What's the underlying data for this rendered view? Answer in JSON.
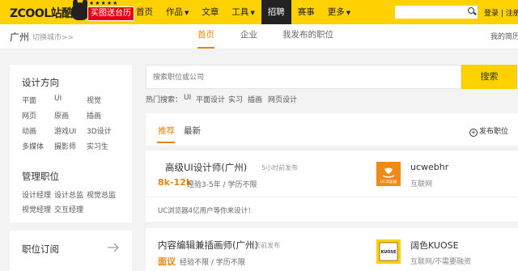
{
  "header": {
    "logo_text": "ZCOOL站酷",
    "promo": "买图送台历",
    "nav": [
      {
        "label": "首页"
      },
      {
        "label": "作品",
        "caret": "▼"
      },
      {
        "label": "文章"
      },
      {
        "label": "工具",
        "caret": "▼"
      },
      {
        "label": "招聘"
      },
      {
        "label": "赛事"
      },
      {
        "label": "更多",
        "caret": "▼"
      }
    ],
    "search_placeholder": "",
    "auth": "登录 | 注册"
  },
  "subheader": {
    "city": "广州",
    "switch_city": "切换城市>>",
    "tabs": [
      "首页",
      "企业",
      "我发布的职位"
    ],
    "resume": "我的简历"
  },
  "sidebar": {
    "design_title": "设计方向",
    "design_links": [
      "平面",
      "UI",
      "视觉",
      "网页",
      "原画",
      "插画",
      "动画",
      "游戏UI",
      "3D设计",
      "多媒体",
      "摄影师",
      "实习生"
    ],
    "manage_title": "管理职位",
    "manage_links": [
      "设计经理",
      "设计总监",
      "视觉总监",
      "视觉经理",
      "交互经理"
    ],
    "subscribe_title": "职位订阅"
  },
  "search": {
    "placeholder": "搜索职位或公司",
    "button": "搜索",
    "hot_label": "热门搜索：",
    "hot_tags": [
      "UI",
      "平面设计",
      "实习",
      "插画",
      "网页设计"
    ]
  },
  "list": {
    "tabs": [
      "推荐",
      "最新"
    ],
    "publish": "发布职位",
    "jobs": [
      {
        "title": "高级UI设计师(广州)",
        "time": "5小时前发布",
        "salary": "8k-12k",
        "req": "经验3-5年 / 学历不限",
        "company": "ucwebhr",
        "industry": "互联网",
        "desc": "UC浏览器4亿用户等你来设计！",
        "logo_text": "UC浏览器"
      },
      {
        "title": "内容编辑兼插画师(广州)",
        "time": "1天前发布",
        "salary": "面议",
        "req": "经验不限 / 学历不限",
        "company": "阔色KUOSE",
        "industry": "互联网/不需要融资",
        "logo_text": "KUOSE"
      }
    ]
  },
  "colors": {
    "brand_yellow": "#ffd100",
    "accent_orange": "#e8860c",
    "promo_red": "#e60012"
  }
}
